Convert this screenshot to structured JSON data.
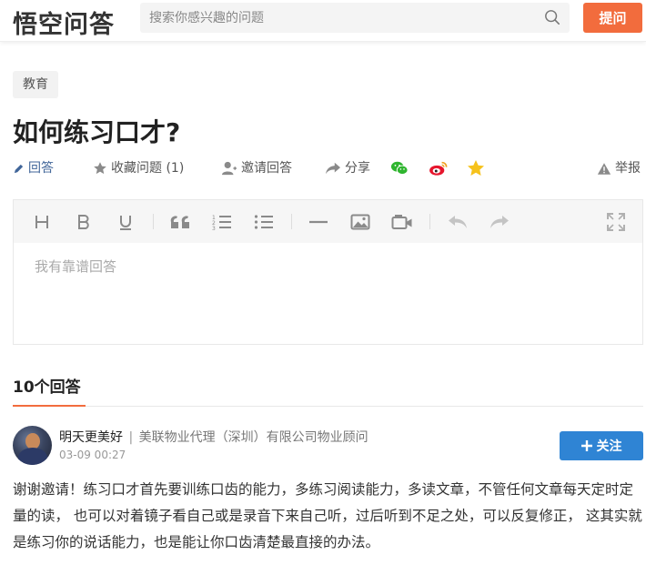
{
  "header": {
    "logo": "悟空问答",
    "search_placeholder": "搜索你感兴趣的问题",
    "ask_button": "提问"
  },
  "question": {
    "category": "教育",
    "title": "如何练习口才?"
  },
  "actions": {
    "answer": "回答",
    "collect": "收藏问题 (1)",
    "invite": "邀请回答",
    "share": "分享",
    "report": "举报"
  },
  "editor": {
    "placeholder": "我有靠谱回答"
  },
  "answers": {
    "count_label": "10个回答"
  },
  "answer": {
    "author_name": "明天更美好",
    "author_title": "美联物业代理（深圳）有限公司物业顾问",
    "time": "03-09 00:27",
    "follow_label": "关注",
    "content": "谢谢邀请！练习口才首先要训练口齿的能力，多练习阅读能力，多读文章，不管任何文章每天定时定量的读， 也可以对着镜子看自己或是录音下来自己听，过后听到不足之处，可以反复修正， 这其实就是练习你的说话能力，也是能让你口齿清楚最直接的办法。"
  },
  "colors": {
    "brand": "#f26c3d",
    "link_blue": "#406599",
    "follow_blue": "#2f84d4"
  }
}
